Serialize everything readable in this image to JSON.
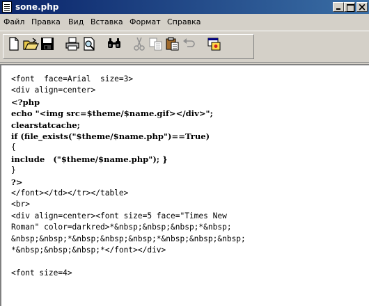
{
  "window": {
    "title": "sone.php"
  },
  "menu": [
    {
      "label": "Файл"
    },
    {
      "label": "Правка"
    },
    {
      "label": "Вид"
    },
    {
      "label": "Вставка"
    },
    {
      "label": "Формат"
    },
    {
      "label": "Справка"
    }
  ],
  "toolbar": {
    "buttons": [
      {
        "icon": "new-document-icon"
      },
      {
        "icon": "open-folder-icon"
      },
      {
        "icon": "save-icon"
      },
      {
        "icon": "print-icon"
      },
      {
        "icon": "print-preview-icon"
      },
      {
        "icon": "find-icon"
      },
      {
        "icon": "cut-icon"
      },
      {
        "icon": "copy-icon"
      },
      {
        "icon": "paste-icon"
      },
      {
        "icon": "undo-icon"
      },
      {
        "icon": "insert-object-icon"
      }
    ]
  },
  "editor": {
    "lines": [
      {
        "text": "<font  face=Arial  size=3>",
        "bold": false
      },
      {
        "text": "<div align=center>",
        "bold": false
      },
      {
        "text": "<?php",
        "bold": true
      },
      {
        "text": "echo \"<img src=$theme/$name.gif></div>\";",
        "bold": true
      },
      {
        "text": "clearstatcache;",
        "bold": true
      },
      {
        "text": "if (file_exists(\"$theme/$name.php\")==True)",
        "bold": true
      },
      {
        "text": "{",
        "bold": false
      },
      {
        "text": "include   (\"$theme/$name.php\"); }",
        "bold": true
      },
      {
        "text": "}",
        "bold": false
      },
      {
        "text": "?>",
        "bold": true
      },
      {
        "text": "</font></td></tr></table>",
        "bold": false
      },
      {
        "text": "<br>",
        "bold": false
      },
      {
        "text": "<div align=center><font size=5 face=\"Times New",
        "bold": false
      },
      {
        "text": "Roman\" color=darkred>*&nbsp;&nbsp;&nbsp;*&nbsp;",
        "bold": false
      },
      {
        "text": "&nbsp;&nbsp;*&nbsp;&nbsp;&nbsp;*&nbsp;&nbsp;&nbsp;",
        "bold": false
      },
      {
        "text": "*&nbsp;&nbsp;&nbsp;*</font></div>",
        "bold": false
      },
      {
        "text": "",
        "bold": false
      },
      {
        "text": "<font size=4>",
        "bold": false
      }
    ]
  }
}
